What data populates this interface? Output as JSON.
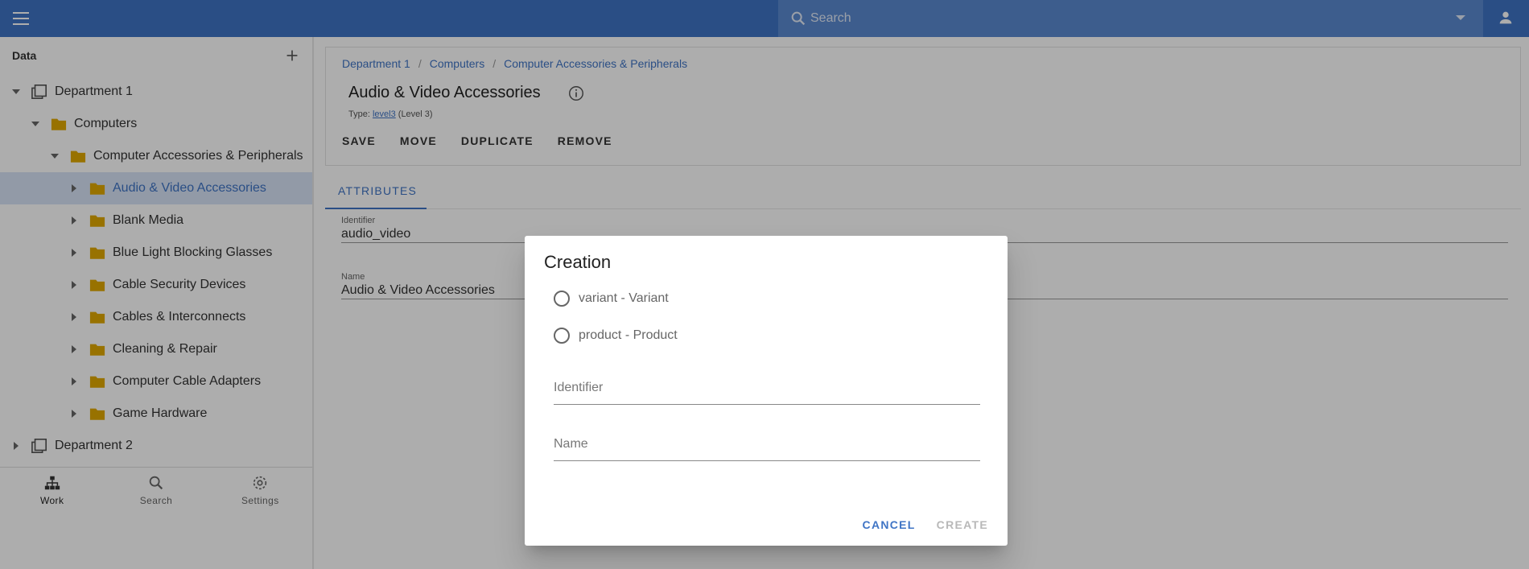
{
  "topbar": {
    "search_placeholder": "Search"
  },
  "left_panel": {
    "title": "Data",
    "tree": [
      {
        "label": "Department 1",
        "level": 0,
        "expanded": true,
        "icon": "library-icon"
      },
      {
        "label": "Computers",
        "level": 1,
        "expanded": true,
        "icon": "folder-icon"
      },
      {
        "label": "Computer Accessories & Peripherals",
        "level": 2,
        "expanded": true,
        "icon": "folder-icon"
      },
      {
        "label": "Audio & Video Accessories",
        "level": 3,
        "expanded": false,
        "icon": "folder-icon",
        "selected": true
      },
      {
        "label": "Blank Media",
        "level": 3,
        "expanded": false,
        "icon": "folder-icon"
      },
      {
        "label": "Blue Light Blocking Glasses",
        "level": 3,
        "expanded": false,
        "icon": "folder-icon"
      },
      {
        "label": "Cable Security Devices",
        "level": 3,
        "expanded": false,
        "icon": "folder-icon"
      },
      {
        "label": "Cables & Interconnects",
        "level": 3,
        "expanded": false,
        "icon": "folder-icon"
      },
      {
        "label": "Cleaning & Repair",
        "level": 3,
        "expanded": false,
        "icon": "folder-icon"
      },
      {
        "label": "Computer Cable Adapters",
        "level": 3,
        "expanded": false,
        "icon": "folder-icon"
      },
      {
        "label": "Game Hardware",
        "level": 3,
        "expanded": false,
        "icon": "folder-icon"
      },
      {
        "label": "Department 2",
        "level": 0,
        "expanded": false,
        "icon": "library-icon"
      }
    ],
    "bottom_nav": [
      {
        "label": "Work",
        "icon": "sitemap-icon",
        "active": true
      },
      {
        "label": "Search",
        "icon": "search-icon",
        "active": false
      },
      {
        "label": "Settings",
        "icon": "gear-icon",
        "active": false
      }
    ]
  },
  "main": {
    "breadcrumb": [
      "Department 1",
      "Computers",
      "Computer Accessories & Peripherals"
    ],
    "title": "Audio & Video Accessories",
    "type_prefix": "Type:",
    "type_link": "level3",
    "type_suffix": "(Level 3)",
    "actions": [
      "SAVE",
      "MOVE",
      "DUPLICATE",
      "REMOVE"
    ],
    "tab": "ATTRIBUTES",
    "fields": [
      {
        "label": "Identifier",
        "value": "audio_video"
      },
      {
        "label": "Name",
        "value": "Audio & Video Accessories"
      }
    ]
  },
  "dialog": {
    "title": "Creation",
    "options": [
      "variant - Variant",
      "product - Product"
    ],
    "identifier_placeholder": "Identifier",
    "name_placeholder": "Name",
    "cancel_label": "CANCEL",
    "create_label": "CREATE"
  },
  "colors": {
    "primary": "#3f74c5",
    "folder": "#e0a800",
    "selected_row": "#d7e3f6"
  }
}
